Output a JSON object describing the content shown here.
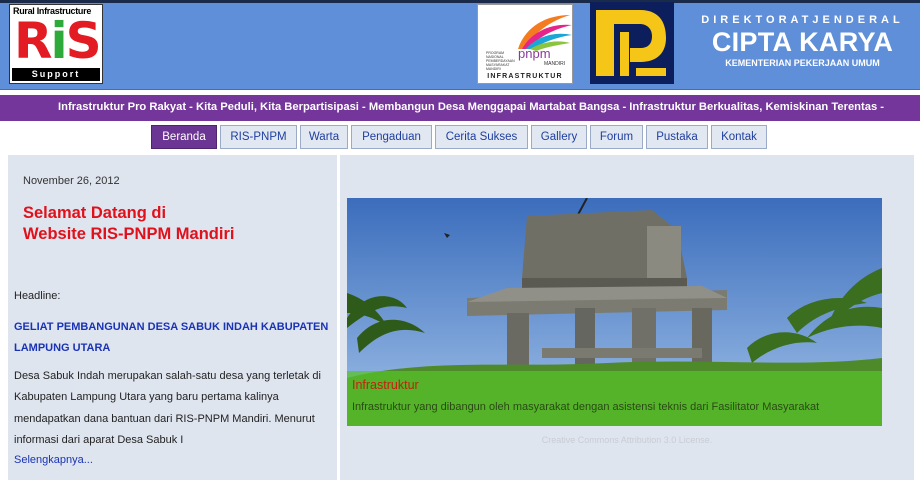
{
  "header": {
    "ris_logo": {
      "top": "Rural Infrastructure",
      "letters": "RiS",
      "bottom": "Support"
    },
    "pnpm_logo": {
      "brand": "pnpm",
      "mandiri": "MANDIRI",
      "subtitle": "INFRASTRUKTUR",
      "small": "PROGRAM NASIONAL PEMBERDAYAAN MASYARAKAT MANDIRI"
    },
    "directorate": "DIREKTORATJENDERAL",
    "title": "CIPTA KARYA",
    "ministry": "KEMENTERIAN PEKERJAAN UMUM"
  },
  "marquee": "Infrastruktur Pro Rakyat - Kita Peduli, Kita Berpartisipasi - Membangun Desa Menggapai Martabat Bangsa - Infrastruktur Berkualitas, Kemiskinan Terentas -",
  "nav": {
    "items": [
      "Beranda",
      "RIS-PNPM",
      "Warta",
      "Pengaduan",
      "Cerita Sukses",
      "Gallery",
      "Forum",
      "Pustaka",
      "Kontak"
    ],
    "active": "Beranda"
  },
  "left": {
    "date": "November 26, 2012",
    "welcome_line1": "Selamat Datang di",
    "welcome_line2": "Website RIS-PNPM Mandiri",
    "headline_label": "Headline:",
    "headline_title": "GELIAT PEMBANGUNAN DESA SABUK INDAH KABUPATEN LAMPUNG UTARA",
    "headline_body": "Desa Sabuk Indah merupakan salah-satu desa yang terletak di Kabupaten Lampung Utara yang baru pertama kalinya mendapatkan dana bantuan dari RIS-PNPM Mandiri. Menurut informasi dari aparat Desa Sabuk I",
    "read_more": "Selengkapnya..."
  },
  "slideshow": {
    "caption_title": "Infrastruktur",
    "caption_text": "Infrastruktur yang dibangun oleh masyarakat dengan asistensi teknis dari Fasilitator Masyarakat",
    "license": "Creative Commons Attribution 3.0 License."
  },
  "colors": {
    "header_blue": "#5f8fd8",
    "purple": "#74369a",
    "panel": "#dfe5ef",
    "welcome_red": "#e0111b",
    "link_blue": "#1a33b4"
  }
}
